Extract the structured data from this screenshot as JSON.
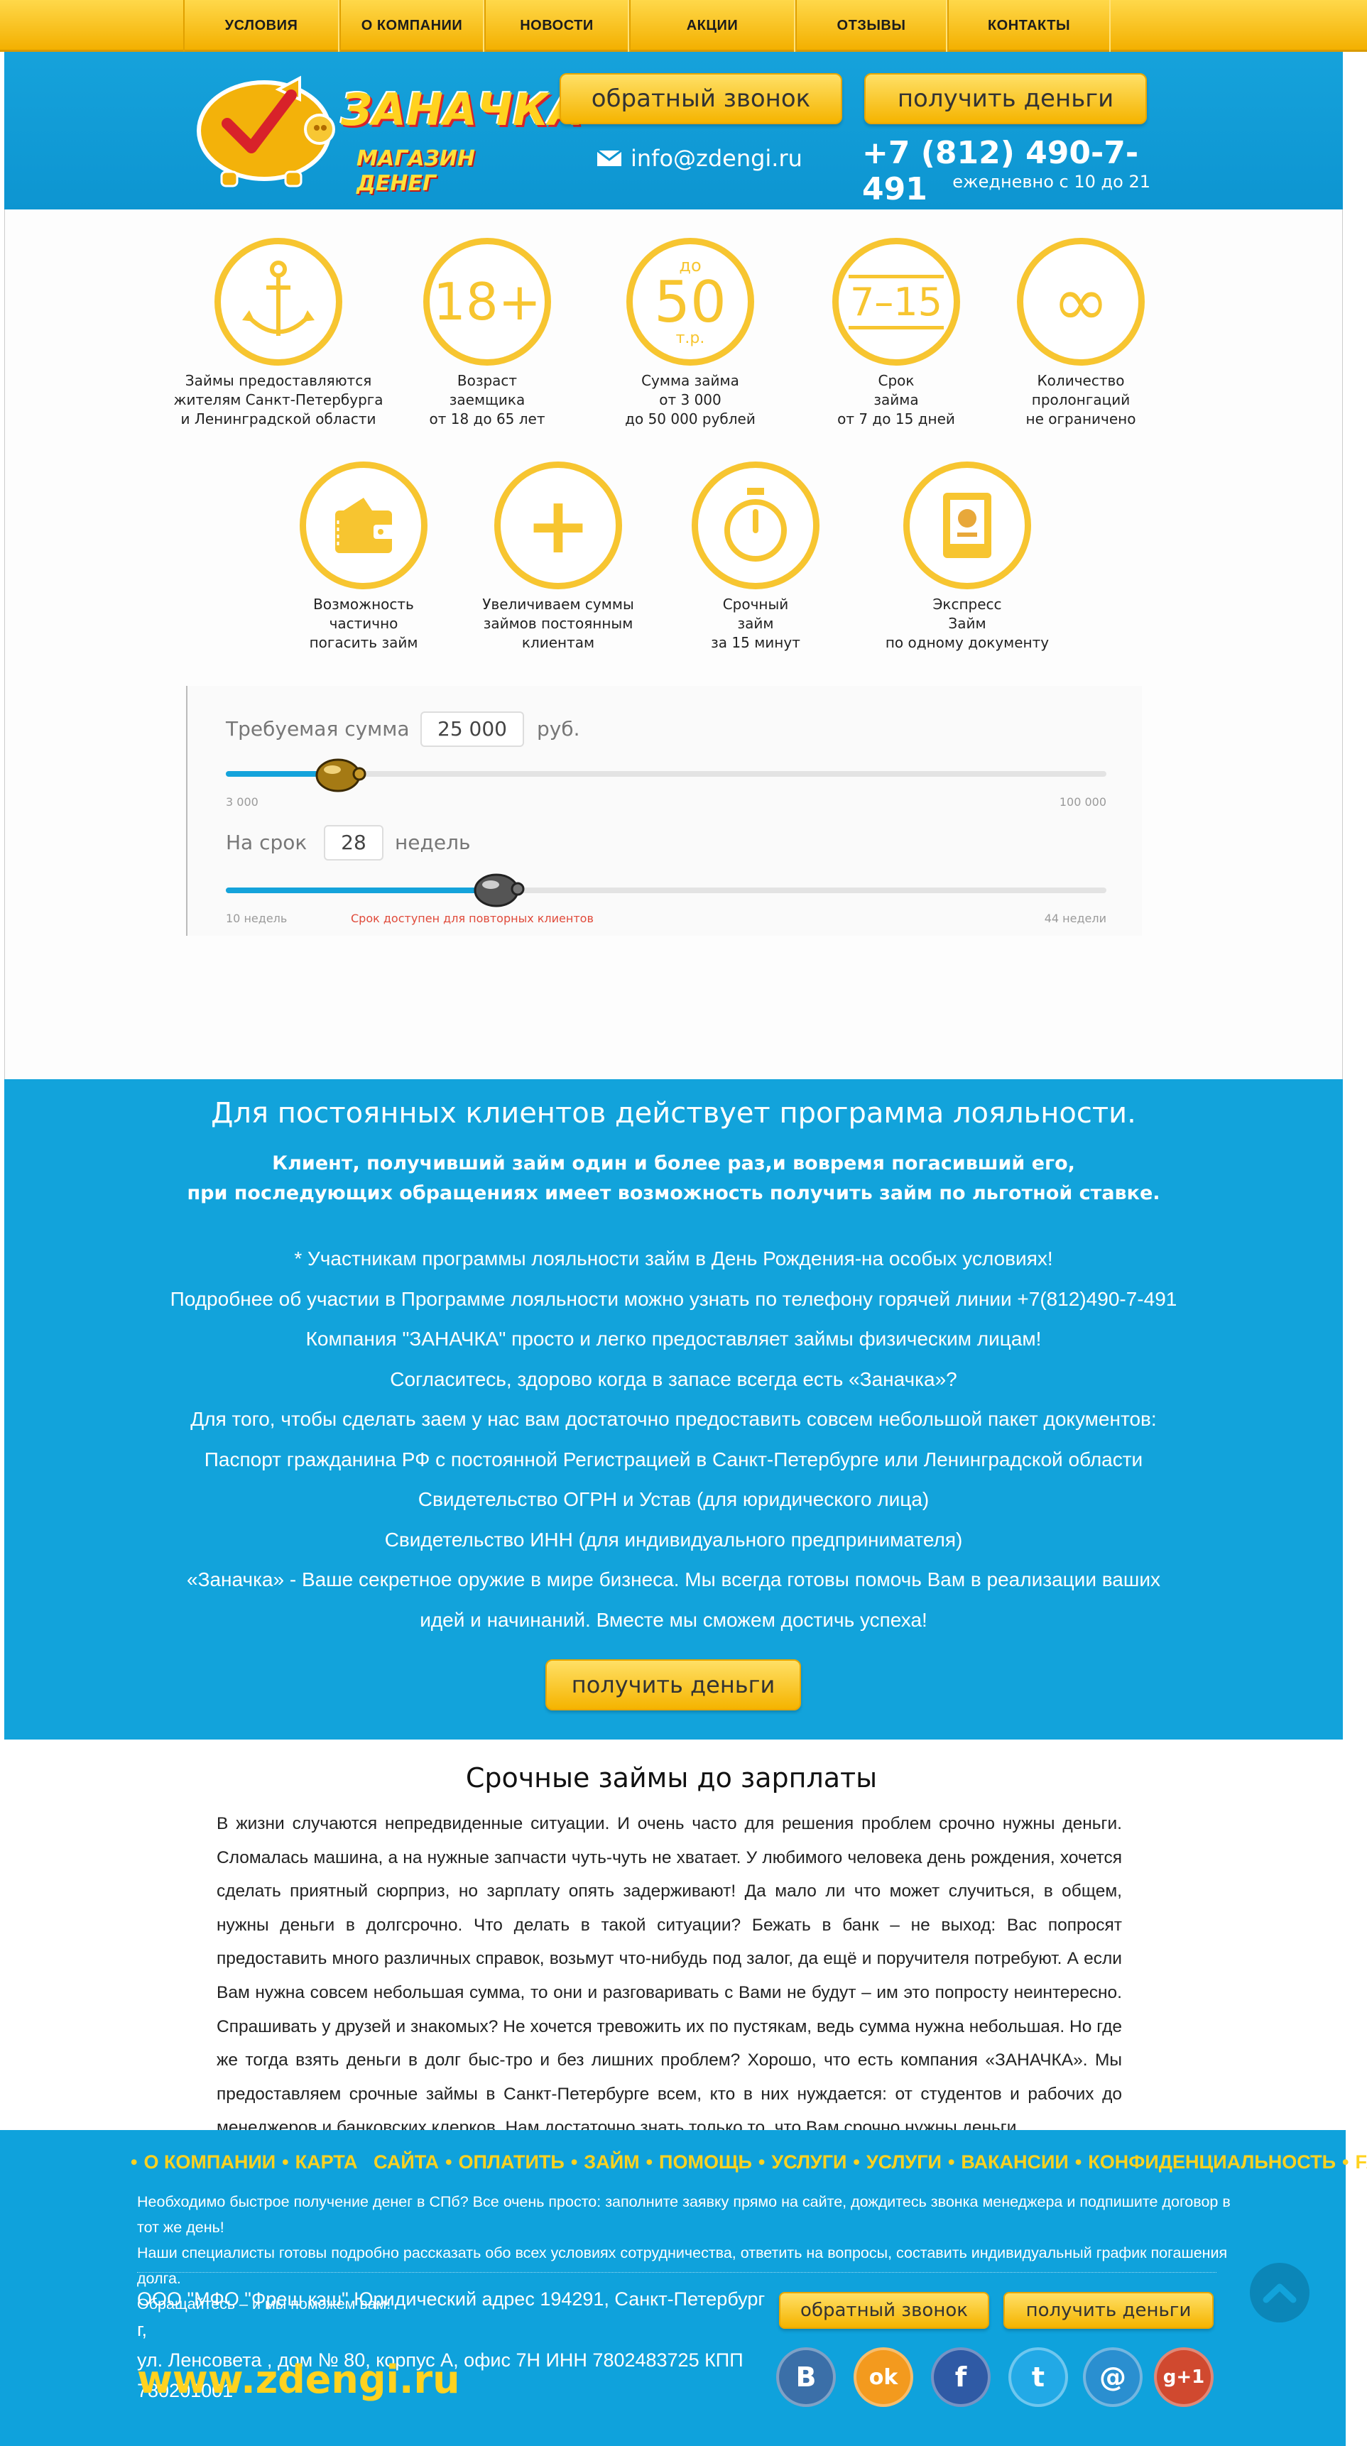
{
  "nav": {
    "items": [
      "условия",
      "о компании",
      "новости",
      "акции",
      "отзывы",
      "контакты"
    ]
  },
  "header": {
    "logo_name": "ЗАНАЧКА",
    "logo_subtitle": "МАГАЗИН ДЕНЕГ",
    "callback_label": "обратный звонок",
    "get_money_label": "получить деньги",
    "email": "info@zdengi.ru",
    "phone": "+7 (812) 490-7-491",
    "hours": "ежедневно с 10 до 21"
  },
  "features": [
    {
      "icon": "anchor-icon",
      "caption": "Займы предоставляются\nжителям Санкт-Петербурга\nи Ленинградской области"
    },
    {
      "icon": "age-icon",
      "icon_text": "18+",
      "caption": "Возраст\nзаемщика\nот 18 до 65 лет"
    },
    {
      "icon": "amount-icon",
      "icon_text": "50",
      "icon_top": "до",
      "icon_bottom": "т.р.",
      "caption": "Сумма займа\nот 3 000\nдо 50 000 рублей"
    },
    {
      "icon": "term-icon",
      "icon_text": "7–15",
      "caption": "Срок\nзайма\nот 7 до 15 дней"
    },
    {
      "icon": "infinity-icon",
      "icon_text": "∞",
      "caption": "Количество\nпролонгаций\nне ограничено"
    },
    {
      "icon": "wallet-icon",
      "caption": "Возможность\nчастично\nпогасить займ"
    },
    {
      "icon": "plus-icon",
      "icon_text": "+",
      "caption": "Увеличиваем суммы\nзаймов постоянным\nклиентам"
    },
    {
      "icon": "stopwatch-icon",
      "caption": "Срочный\nзайм\nза 15 минут"
    },
    {
      "icon": "document-icon",
      "caption": "Экспресс\nЗайм\nпо одному документу"
    }
  ],
  "calculator": {
    "amount_label": "Требуемая сумма",
    "amount_value": "25 000",
    "amount_unit": "руб.",
    "amount_min": "3 000",
    "amount_max": "100 000",
    "amount_fraction": 0.13,
    "term_label": "На срок",
    "term_value": "28",
    "term_unit": "недель",
    "term_min": "10 недель",
    "term_max": "44 недели",
    "term_fraction": 0.31,
    "term_note": "Срок доступен для повторных клиентов"
  },
  "loyalty": {
    "title": "Для постоянных клиентов действует программа лояльности.",
    "bold_line1": "Клиент, получивший займ один и более раз,и вовремя погасивший его,",
    "bold_line2": "при последующих обращениях имеет возможность получить займ по льготной ставке.",
    "lines": [
      "* Участникам программы лояльности займ в День Рождения-на особых условиях!",
      "Подробнее об участии в Программе лояльности можно узнать по телефону горячей линии +7(812)490-7-491",
      "Компания \"ЗАНАЧКА\" просто и легко предоставляет займы физическим лицам!",
      "Согласитесь, здорово когда в запасе всегда есть «Заначка»?",
      "Для того, чтобы сделать заем у нас вам достаточно предоставить совсем небольшой пакет документов:",
      "Паспорт гражданина РФ с постоянной Регистрацией в Санкт-Петербурге или Ленинградской области",
      "Свидетельство ОГРН и Устав (для юридического лица)",
      "Свидетельство ИНН (для индивидуального предпринимателя)",
      "«Заначка» - Ваше секретное оружие в мире бизнеса. Мы всегда готовы помочь Вам в реализации ваших",
      "идей и начинаний. Вместе мы сможем достичь успеха!"
    ],
    "button_label": "получить деньги"
  },
  "article": {
    "title": "Срочные займы до зарплаты",
    "body": "В жизни случаются непредвиденные ситуации. И очень часто для решения проблем срочно нужны деньги. Сломалась машина, а на нужные запчасти чуть-чуть не хватает. У любимого человека день рождения, хочется сделать приятный сюрприз, но зарплату опять задерживают! Да мало ли что может случиться, в общем, нужны деньги в долгсрочно. Что делать в такой ситуации? Бежать в банк – не выход: Вас попросят предоставить много различных справок, возьмут что-нибудь под залог, да ещё и поручителя  потребуют. А если Вам нужна совсем небольшая сумма, то они и разговаривать с Вами  не будут – им это попросту неинтересно. Спрашивать у друзей и знакомых?  Не хочется тревожить их по пустякам, ведь сумма нужна небольшая. Но где же тогда взять деньги  в долг быс-тро и без лишних проблем? Хорошо, что есть компания «ЗАНАЧКА».  Мы предоставляем срочные займы в Санкт-Петербурге всем, кто в них нуждается: от студентов и рабочих до менеджеров и банковских клерков. Нам достаточно знать только то, что Вам срочно нужны деньги."
  },
  "footer": {
    "menu": [
      "О КОМПАНИИ",
      "КАРТА   САЙТА",
      "ОПЛАТИТЬ",
      "ЗАЙМ",
      "ПОМОЩЬ",
      "УСЛУГИ",
      "УСЛУГИ",
      "ВАКАНСИИ",
      "КОНФИДЕНЦИАЛЬНОСТЬ",
      "FAQ"
    ],
    "text_line1": "Необходимо быстрое получение денег в СПб? Все очень просто: заполните заявку прямо на сайте, дождитесь звонка менеджера и подпишите договор в тот же день!",
    "text_line2": "Наши специалисты готовы подробно рассказать обо всех условиях сотрудничества, ответить на вопросы, составить индивидуальный график погашения долга.",
    "text_line3": "Обращайтесь – и мы поможем вам!",
    "company_line1": "ООО  \"МФО \"Фреш кэш\" Юридический адрес 194291, Санкт-Петербург г,",
    "company_line2": "ул. Ленсовета , дом № 80, корпус А, офис 7Н  ИНН 7802483725   КПП 780201001",
    "site": "www.zdengi.ru",
    "callback_label": "обратный звонок",
    "get_money_label": "получить деньги",
    "social": [
      {
        "icon": "vk-icon",
        "glyph": "В",
        "color": "#3b6fa8"
      },
      {
        "icon": "odnoklassniki-icon",
        "glyph": "ok",
        "color": "#f39a1e"
      },
      {
        "icon": "facebook-icon",
        "glyph": "f",
        "color": "#2f5aa5"
      },
      {
        "icon": "twitter-icon",
        "glyph": "t",
        "color": "#22a9e6"
      },
      {
        "icon": "mail-icon",
        "glyph": "@",
        "color": "#2a8fd0"
      },
      {
        "icon": "google-plus-icon",
        "glyph": "g+1",
        "color": "#d0492f"
      }
    ]
  }
}
